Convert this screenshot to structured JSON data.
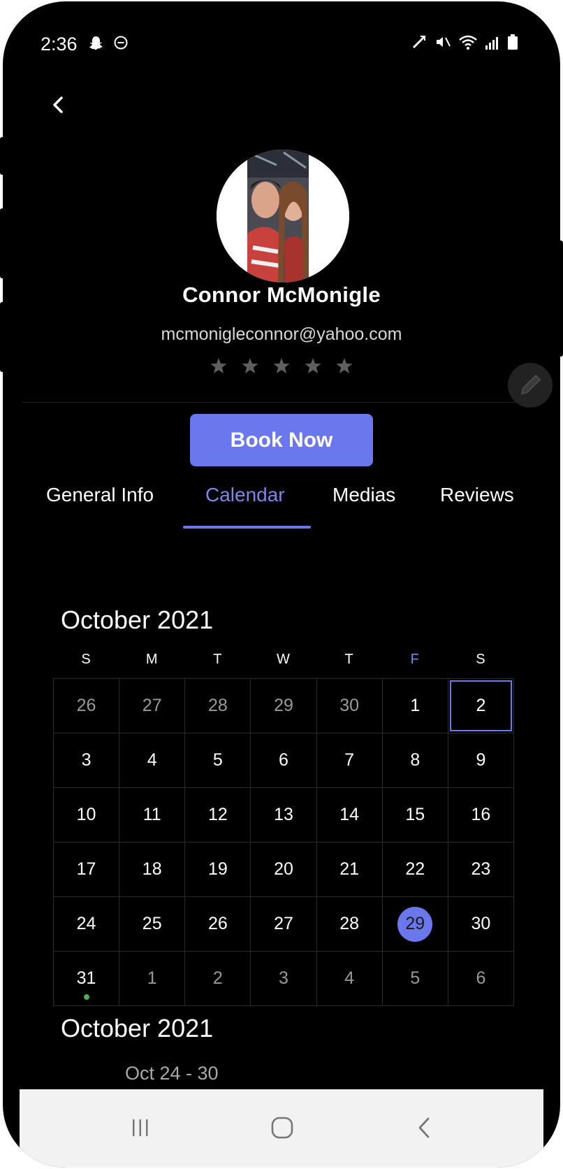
{
  "status_bar": {
    "time": "2:36",
    "left_icons": [
      "snapchat-icon",
      "do-not-disturb-icon"
    ],
    "right_icons": [
      "nfc-icon",
      "mute-icon",
      "wifi-icon",
      "signal-icon",
      "battery-icon"
    ]
  },
  "profile": {
    "name": "Connor McMonigle",
    "email": "mcmonigleconnor@yahoo.com",
    "rating": 0,
    "rating_max": 5
  },
  "actions": {
    "book_now_label": "Book Now"
  },
  "tabs": [
    {
      "label": "General Info",
      "active": false
    },
    {
      "label": "Calendar",
      "active": true
    },
    {
      "label": "Medias",
      "active": false
    },
    {
      "label": "Reviews",
      "active": false
    }
  ],
  "calendar": {
    "title": "October 2021",
    "days_of_week": [
      "S",
      "M",
      "T",
      "W",
      "T",
      "F",
      "S"
    ],
    "weeks": [
      [
        "26",
        "27",
        "28",
        "29",
        "30",
        "1",
        "2"
      ],
      [
        "3",
        "4",
        "5",
        "6",
        "7",
        "8",
        "9"
      ],
      [
        "10",
        "11",
        "12",
        "13",
        "14",
        "15",
        "16"
      ],
      [
        "17",
        "18",
        "19",
        "20",
        "21",
        "22",
        "23"
      ],
      [
        "24",
        "25",
        "26",
        "27",
        "28",
        "29",
        "30"
      ],
      [
        "31",
        "1",
        "2",
        "3",
        "4",
        "5",
        "6"
      ]
    ],
    "selected_date": "2",
    "today": "29",
    "event_dot_date": "31"
  },
  "agenda": {
    "title": "October 2021",
    "week_range": "Oct 24 - 30"
  },
  "colors": {
    "accent": "#6b78ed",
    "background": "#000000",
    "event_dot": "#4caf50"
  }
}
